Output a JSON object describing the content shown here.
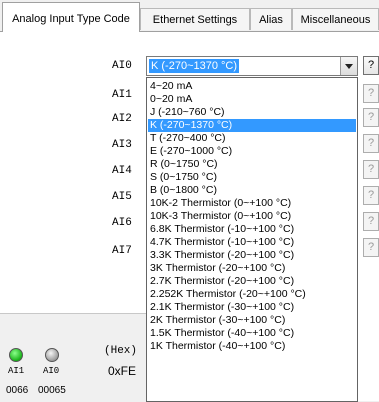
{
  "tabs": [
    {
      "label": "Analog Input Type Code",
      "active": true
    },
    {
      "label": "Ethernet Settings",
      "active": false
    },
    {
      "label": "Alias",
      "active": false
    },
    {
      "label": "Miscellaneous",
      "active": false
    }
  ],
  "channels": [
    "AI0",
    "AI1",
    "AI2",
    "AI3",
    "AI4",
    "AI5",
    "AI6",
    "AI7"
  ],
  "combo": {
    "value": "K (-270~1370 °C)",
    "help_label": "?"
  },
  "dropdown": {
    "selected_index": 3,
    "options": [
      "4~20 mA",
      "0~20 mA",
      "J (-210~760 °C)",
      "K (-270~1370 °C)",
      "T (-270~400 °C)",
      "E (-270~1000 °C)",
      "R (0~1750 °C)",
      "S (0~1750 °C)",
      "B (0~1800 °C)",
      "10K-2 Thermistor (0~+100 °C)",
      "10K-3 Thermistor (0~+100 °C)",
      "6.8K Thermistor (-10~+100 °C)",
      "4.7K Thermistor (-10~+100 °C)",
      "3.3K Thermistor (-20~+100 °C)",
      "3K Thermistor (-20~+100 °C)",
      "2.7K Thermistor (-20~+100 °C)",
      "2.252K Thermistor (-20~+100 °C)",
      "2.1K Thermistor (-30~+100 °C)",
      "2K Thermistor (-30~+100 °C)",
      "1.5K Thermistor (-40~+100 °C)",
      "1K Thermistor (-40~+100 °C)"
    ]
  },
  "bottom": {
    "leds": [
      {
        "label": "AI1",
        "state": "on",
        "code": "0066"
      },
      {
        "label": "AI0",
        "state": "off",
        "code": "00065"
      }
    ],
    "hex_label": "(Hex)",
    "hex_value": "0xFE"
  },
  "colors": {
    "selection": "#3399ff",
    "led_on": "#19b219"
  }
}
